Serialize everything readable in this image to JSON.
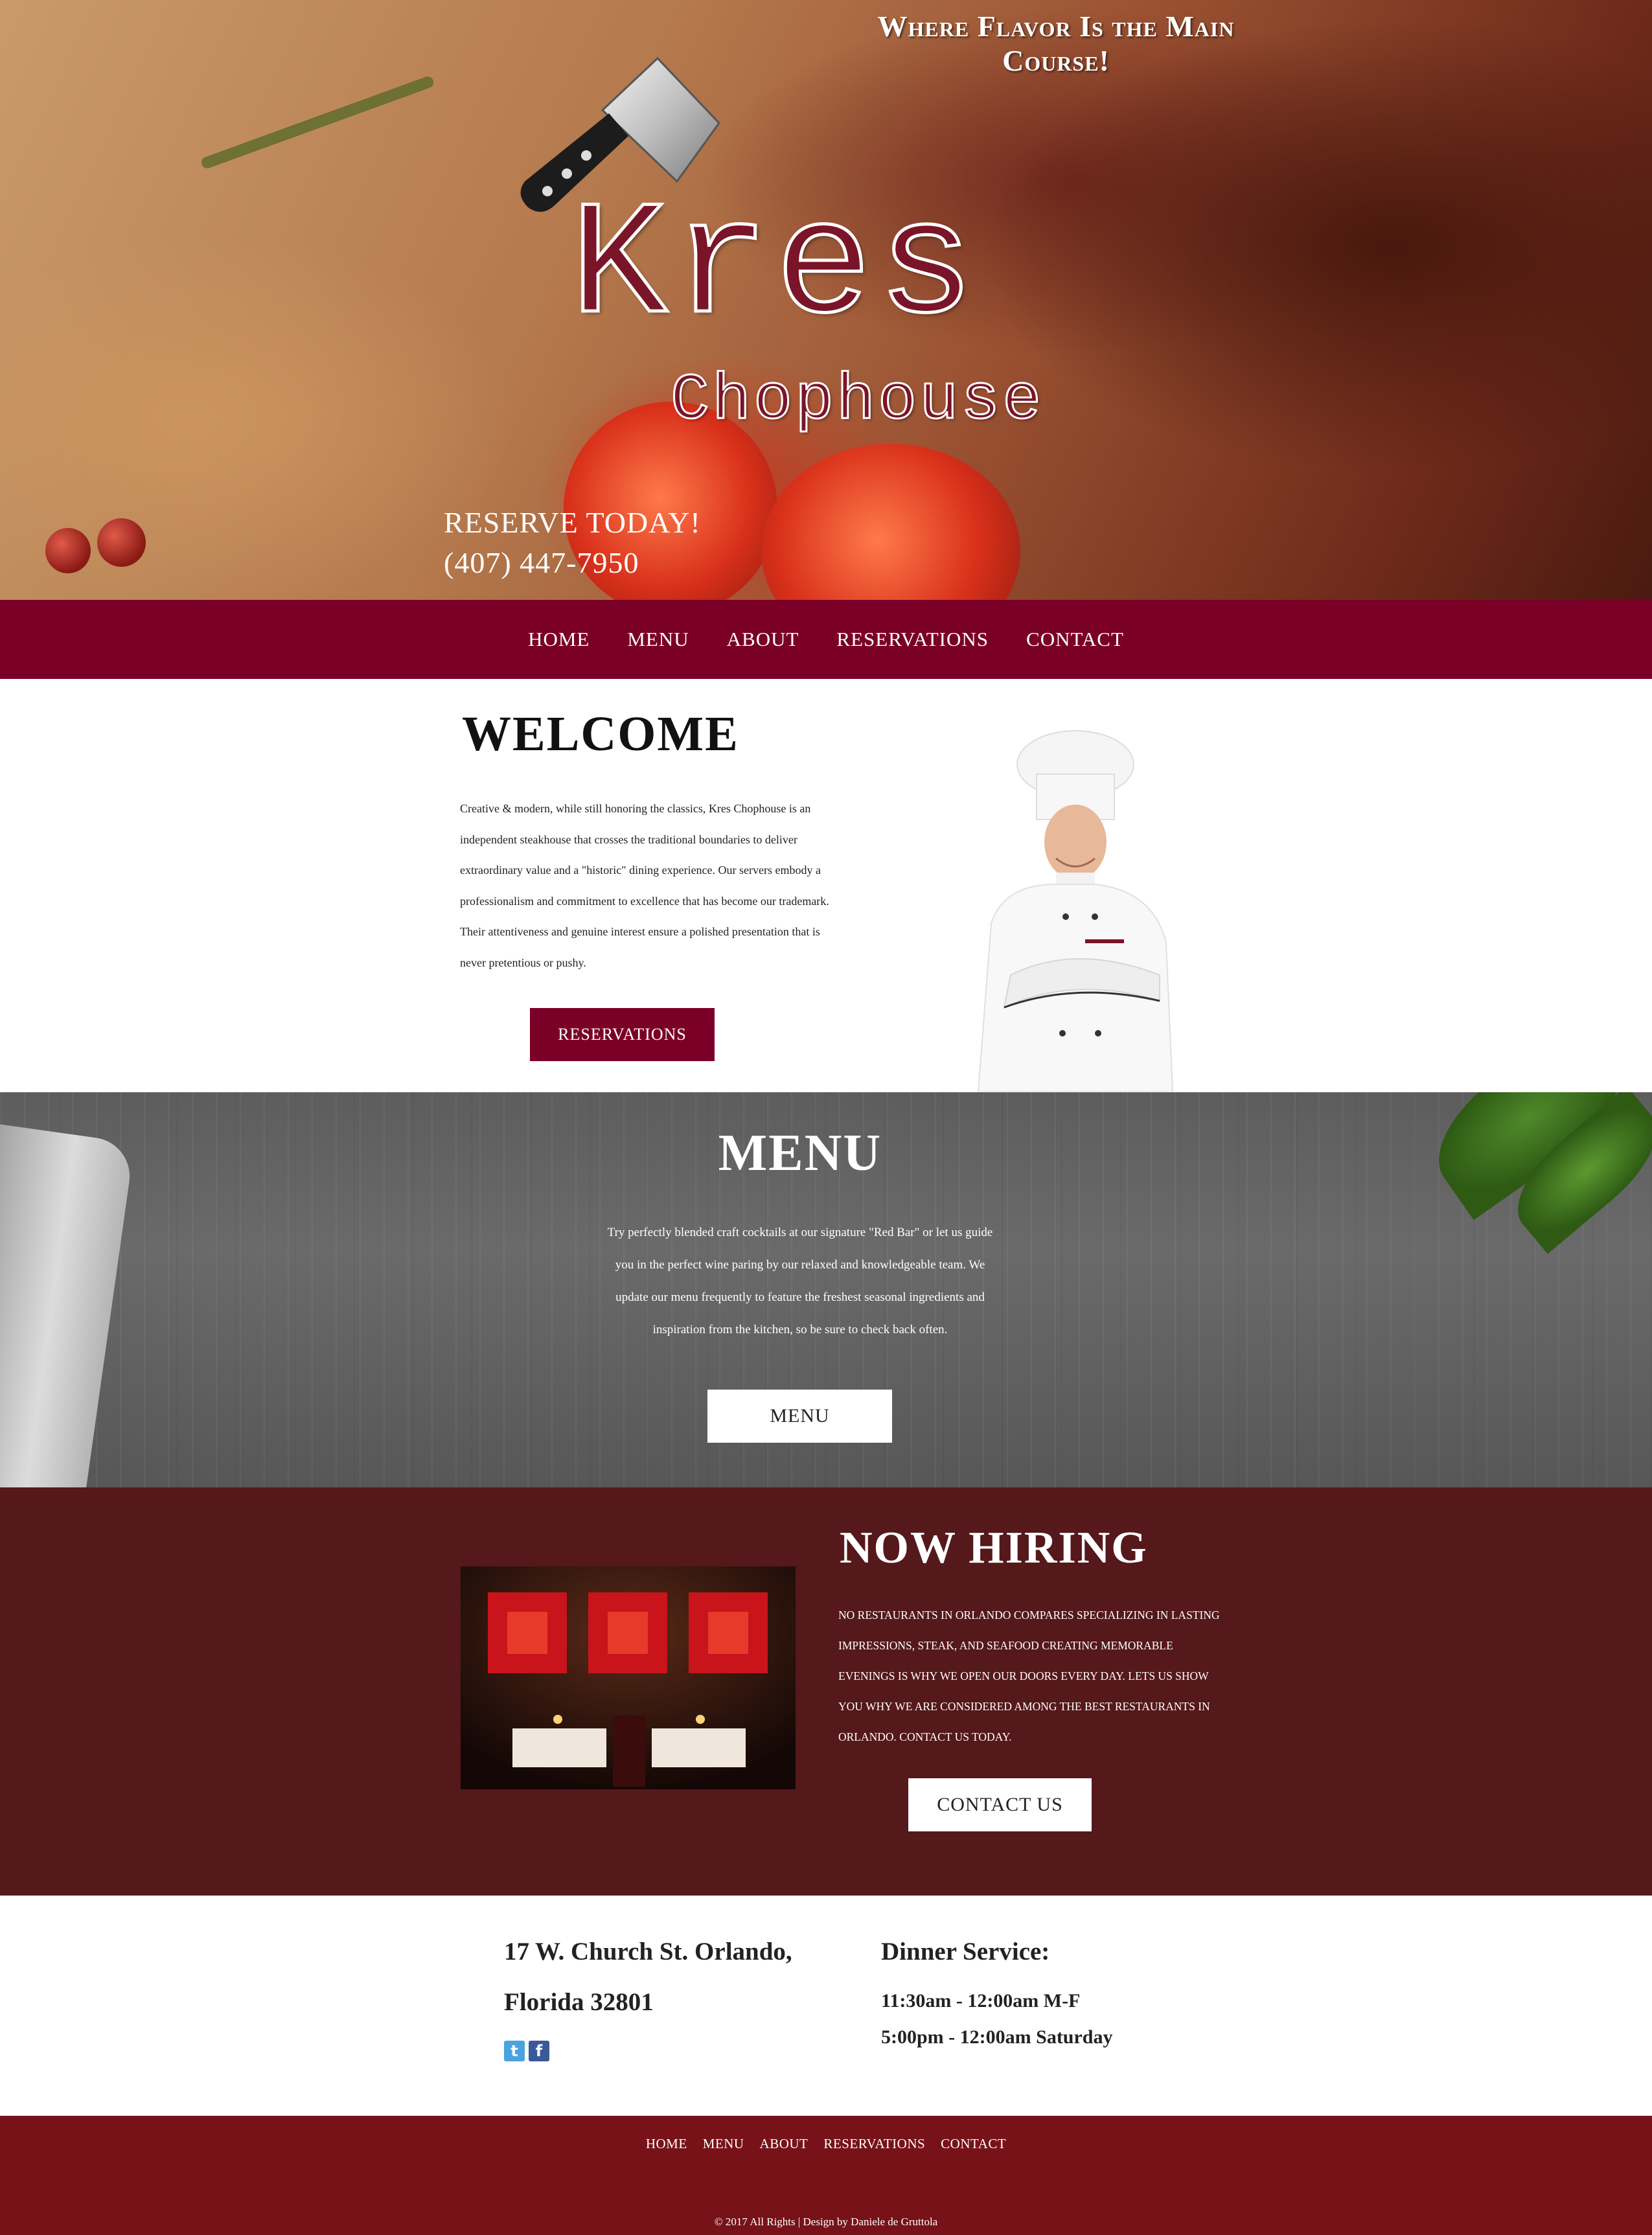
{
  "hero": {
    "tagline": "Where Flavor Is the Main Course!",
    "logo_line1": "Kres",
    "logo_line2": "Chophouse",
    "reserve_title": "RESERVE TODAY!",
    "reserve_phone": "(407) 447-7950"
  },
  "nav": {
    "items": [
      {
        "label": "HOME"
      },
      {
        "label": "MENU"
      },
      {
        "label": "ABOUT"
      },
      {
        "label": "RESERVATIONS"
      },
      {
        "label": "CONTACT"
      }
    ]
  },
  "welcome": {
    "title": "WELCOME",
    "paragraph": "Creative & modern, while still honoring the classics, Kres Chophouse is an independent steakhouse that crosses the traditional boundaries to deliver extraordinary value and a \"historic\" dining experience. Our servers embody a professionalism and commitment to excellence that has become our trademark. Their attentiveness and genuine interest ensure a polished presentation that is never pretentious or pushy.",
    "button_label": "RESERVATIONS"
  },
  "menu_section": {
    "title": "MENU",
    "paragraph": "Try perfectly blended craft cocktails at our signature \"Red Bar\" or let us guide you in the perfect wine paring by our relaxed and knowledgeable team. We update our menu frequently to feature the freshest seasonal ingredients and inspiration from the kitchen, so be sure to check back often.",
    "button_label": "MENU"
  },
  "hiring": {
    "title": "NOW HIRING",
    "paragraph": "NO RESTAURANTS IN ORLANDO COMPAREs SPECIALIZING IN LASTING IMPRESSIONS, STEAK, AND SEAFOOD CREATING MEMORABLE EVENINGS IS WHY WE OPEN OUR DOORS EVERY DAY. LETS US SHOW YOU WHY WE ARE CONSIDERED AMONG THE BEST RESTAURANTS IN ORLANDO. CONTACT US TODAY.",
    "button_label": "CONTACT US"
  },
  "info": {
    "address_line1": "17 W. Church St. Orlando,",
    "address_line2": "Florida 32801",
    "social": [
      {
        "icon": "twitter-icon"
      },
      {
        "icon": "facebook-icon"
      }
    ],
    "hours_title": "Dinner Service:",
    "hours_line1": "11:30am - 12:00am M-F",
    "hours_line2": "5:00pm - 12:00am Saturday"
  },
  "footer": {
    "links": [
      {
        "label": "HOME"
      },
      {
        "label": "MENU"
      },
      {
        "label": "ABOUT"
      },
      {
        "label": "RESERVATIONS"
      },
      {
        "label": "CONTACT"
      }
    ],
    "copyright": "© 2017 All Rights | Design by Daniele de Gruttola"
  },
  "colors": {
    "nav_bg": "#7a0028",
    "hiring_bg": "#55181b",
    "footer_bg": "#771219",
    "menu_bg": "#5d5d5d"
  }
}
